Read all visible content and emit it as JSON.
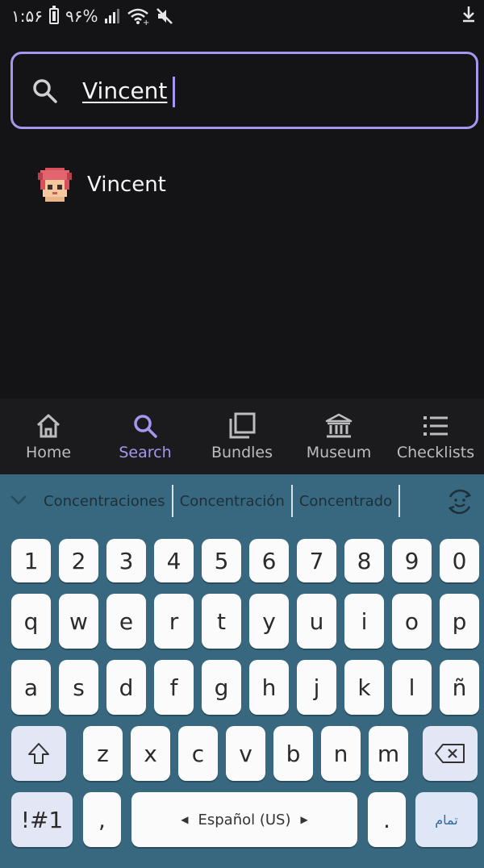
{
  "status_bar": {
    "time": "۱:۵۶",
    "battery_pct": "۹۶%",
    "icons": [
      "battery-icon",
      "signal-icon",
      "wifi-icon",
      "mute-icon",
      "download-icon"
    ]
  },
  "search": {
    "value": "Vincent"
  },
  "results": [
    {
      "label": "Vincent",
      "icon": "villager-portrait-icon"
    }
  ],
  "bottom_nav": [
    {
      "label": "Home",
      "icon": "home-icon",
      "active": false
    },
    {
      "label": "Search",
      "icon": "search-icon",
      "active": true
    },
    {
      "label": "Bundles",
      "icon": "bundles-icon",
      "active": false
    },
    {
      "label": "Museum",
      "icon": "museum-icon",
      "active": false
    },
    {
      "label": "Checklists",
      "icon": "checklist-icon",
      "active": false
    }
  ],
  "keyboard": {
    "suggestions": [
      "Concentraciones",
      "Concentración",
      "Concentrado"
    ],
    "row_numbers": [
      "1",
      "2",
      "3",
      "4",
      "5",
      "6",
      "7",
      "8",
      "9",
      "0"
    ],
    "row_top": [
      "q",
      "w",
      "e",
      "r",
      "t",
      "y",
      "u",
      "i",
      "o",
      "p"
    ],
    "row_middle": [
      "a",
      "s",
      "d",
      "f",
      "g",
      "h",
      "j",
      "k",
      "l",
      "ñ"
    ],
    "row_bottom": [
      "z",
      "x",
      "c",
      "v",
      "b",
      "n",
      "m"
    ],
    "symbols_label": "!#1",
    "comma_label": ",",
    "space_label": "Español (US)",
    "period_label": ".",
    "done_label": "تمام"
  },
  "colors": {
    "accent": "#a596f0",
    "background": "#141416",
    "keyboard": "#37687f"
  }
}
